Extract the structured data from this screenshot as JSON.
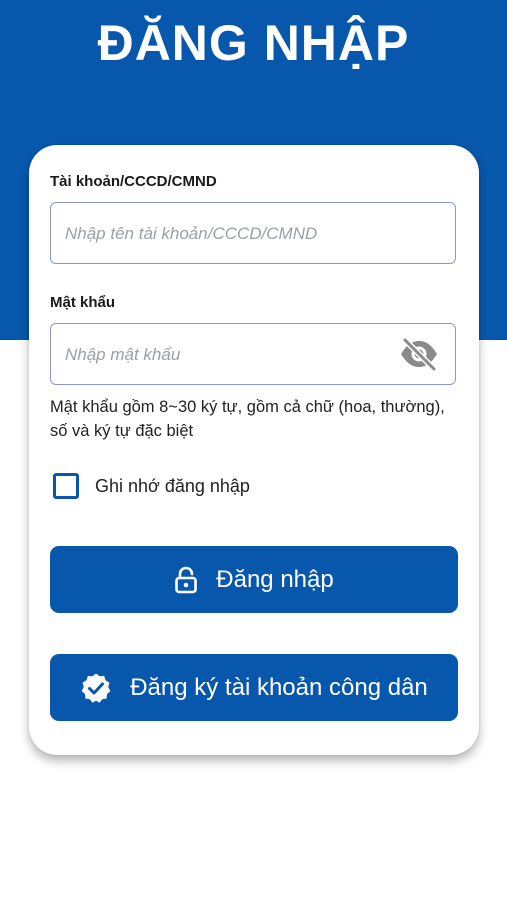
{
  "header": {
    "title": "ĐĂNG NHẬP"
  },
  "form": {
    "account_label": "Tài khoản/CCCD/CMND",
    "account_placeholder": "Nhập tên tài khoản/CCCD/CMND",
    "account_value": "",
    "password_label": "Mật khẩu",
    "password_placeholder": "Nhập mật khẩu",
    "password_value": "",
    "password_hint": "Mật khẩu gồm 8~30 ký tự, gồm cả chữ (hoa, thường), số và ký tự đặc biệt",
    "remember_label": "Ghi nhớ đăng nhập",
    "remember_checked": false
  },
  "buttons": {
    "login_label": "Đăng nhập",
    "register_label": "Đăng ký tài khoản công dân"
  },
  "icons": {
    "password_toggle": "eye-off-icon",
    "login": "unlock-icon",
    "register": "verified-badge-icon"
  },
  "colors": {
    "primary": "#0758ad",
    "input_border": "#8c96d6",
    "placeholder": "#9aa0a6"
  }
}
